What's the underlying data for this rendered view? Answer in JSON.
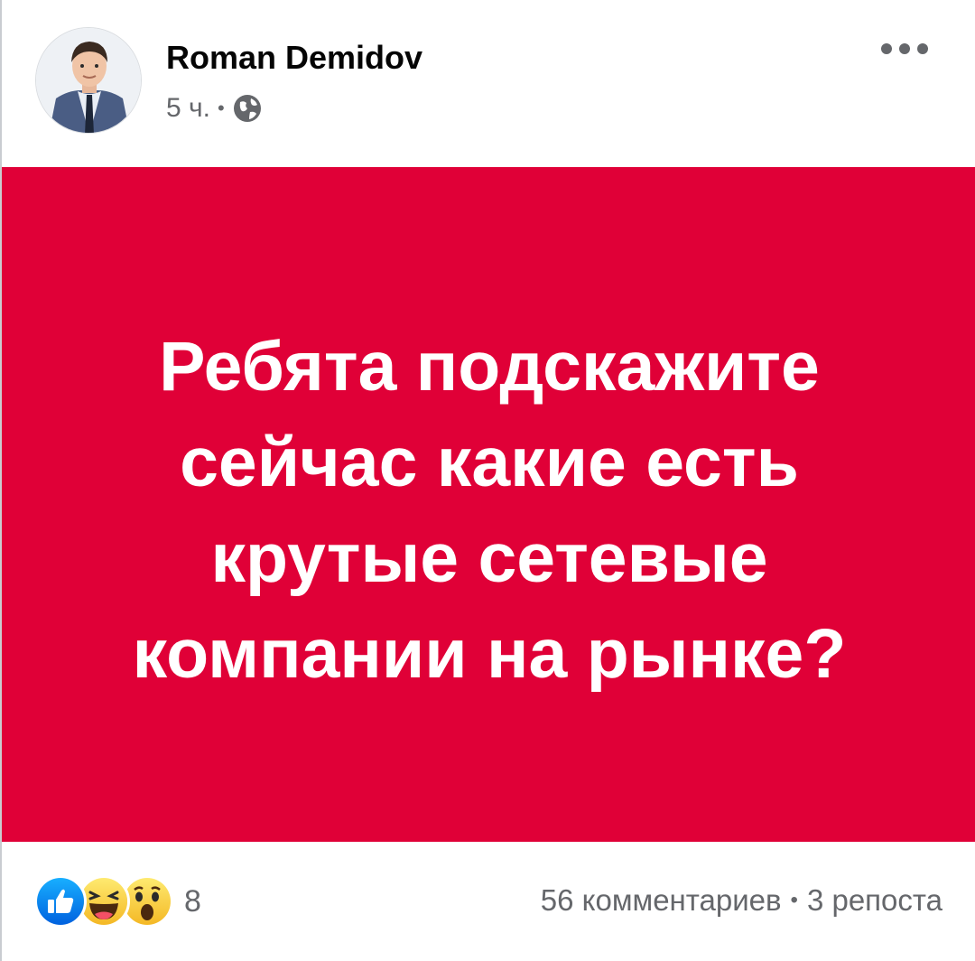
{
  "post": {
    "author": {
      "name": "Roman Demidov",
      "avatar_icon": "profile-photo"
    },
    "meta": {
      "time": "5 ч.",
      "separator": "•",
      "privacy_icon": "globe-icon"
    },
    "more_icon": "more-dots-icon",
    "content": {
      "background_color": "#e00037",
      "text_color": "#ffffff",
      "lines": [
        "Ребята подскажите",
        "сейчас какие есть",
        "крутые сетевые",
        "компании на рынке?"
      ]
    },
    "reactions": {
      "icons": [
        "like-icon",
        "haha-icon",
        "wow-icon"
      ],
      "count": "8"
    },
    "stats": {
      "comments": "56 комментариев",
      "separator": "•",
      "shares": "3 репоста"
    }
  }
}
